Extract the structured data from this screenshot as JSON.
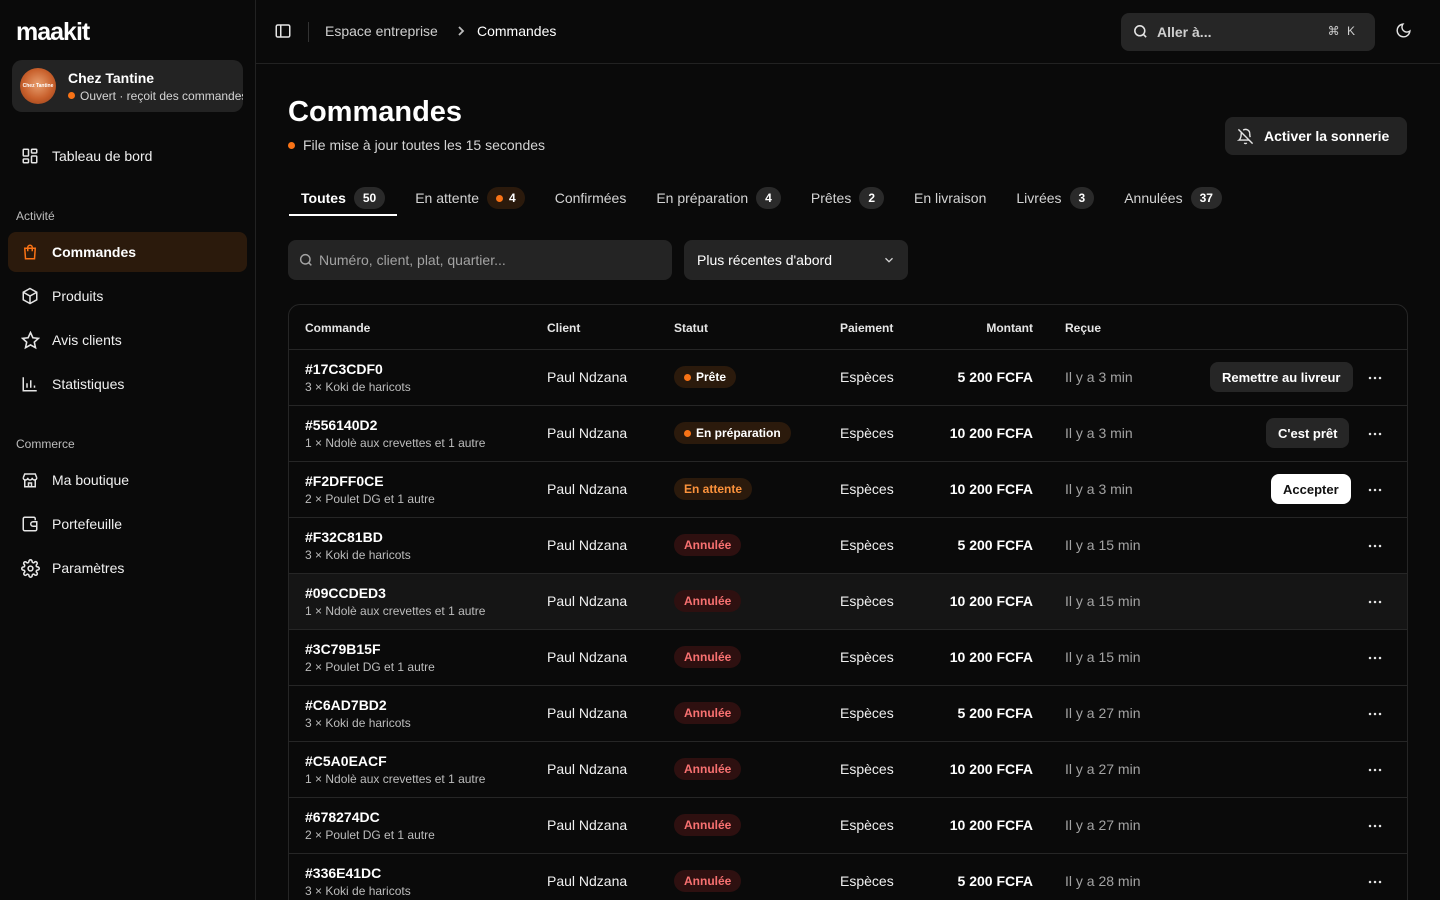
{
  "brand": {
    "logo": "maakit"
  },
  "shop": {
    "name": "Chez Tantine",
    "avatar_text": "Chez Tantine",
    "status": "Ouvert · reçoit des commandes"
  },
  "sidebar": {
    "dashboard": "Tableau de bord",
    "section_activity": "Activité",
    "activity_items": [
      {
        "label": "Commandes",
        "icon": "shopping-bag-icon",
        "active": true
      },
      {
        "label": "Produits",
        "icon": "box-icon",
        "active": false
      },
      {
        "label": "Avis clients",
        "icon": "star-icon",
        "active": false
      },
      {
        "label": "Statistiques",
        "icon": "bar-chart-icon",
        "active": false
      }
    ],
    "section_commerce": "Commerce",
    "commerce_items": [
      {
        "label": "Ma boutique",
        "icon": "store-icon"
      },
      {
        "label": "Portefeuille",
        "icon": "wallet-icon"
      },
      {
        "label": "Paramètres",
        "icon": "gear-icon"
      }
    ]
  },
  "topbar": {
    "breadcrumb": [
      "Espace entreprise",
      "Commandes"
    ],
    "search_label": "Aller à...",
    "shortcut": "⌘ K"
  },
  "header": {
    "title": "Commandes",
    "subtitle": "File mise à jour toutes les 15 secondes",
    "ring_button": "Activer la sonnerie"
  },
  "tabs": [
    {
      "label": "Toutes",
      "count": "50",
      "active": true
    },
    {
      "label": "En attente",
      "count": "4",
      "warn": true
    },
    {
      "label": "Confirmées",
      "count": ""
    },
    {
      "label": "En préparation",
      "count": "4"
    },
    {
      "label": "Prêtes",
      "count": "2"
    },
    {
      "label": "En livraison",
      "count": ""
    },
    {
      "label": "Livrées",
      "count": "3"
    },
    {
      "label": "Annulées",
      "count": "37"
    }
  ],
  "filters": {
    "search_placeholder": "Numéro, client, plat, quartier...",
    "sort_value": "Plus récentes d'abord"
  },
  "table": {
    "columns": [
      "Commande",
      "Client",
      "Statut",
      "Paiement",
      "Montant",
      "Reçue"
    ],
    "rows": [
      {
        "id": "#17C3CDF0",
        "items": "3 × Koki de haricots",
        "client": "Paul Ndzana",
        "status": "Prête",
        "status_kind": "ready",
        "payment": "Espèces",
        "amount": "5 200 FCFA",
        "received": "Il y a 3 min",
        "action": "Remettre au livreur",
        "action_style": "dark"
      },
      {
        "id": "#556140D2",
        "items": "1 × Ndolè aux crevettes et 1 autre",
        "client": "Paul Ndzana",
        "status": "En préparation",
        "status_kind": "prep",
        "payment": "Espèces",
        "amount": "10 200 FCFA",
        "received": "Il y a 3 min",
        "action": "C'est prêt",
        "action_style": "dark"
      },
      {
        "id": "#F2DFF0CE",
        "items": "2 × Poulet DG et 1 autre",
        "client": "Paul Ndzana",
        "status": "En attente",
        "status_kind": "pending",
        "payment": "Espèces",
        "amount": "10 200 FCFA",
        "received": "Il y a 3 min",
        "action": "Accepter",
        "action_style": "light"
      },
      {
        "id": "#F32C81BD",
        "items": "3 × Koki de haricots",
        "client": "Paul Ndzana",
        "status": "Annulée",
        "status_kind": "cancelled",
        "payment": "Espèces",
        "amount": "5 200 FCFA",
        "received": "Il y a 15 min",
        "action": ""
      },
      {
        "id": "#09CCDED3",
        "items": "1 × Ndolè aux crevettes et 1 autre",
        "client": "Paul Ndzana",
        "status": "Annulée",
        "status_kind": "cancelled",
        "payment": "Espèces",
        "amount": "10 200 FCFA",
        "received": "Il y a 15 min",
        "action": "",
        "highlight": true
      },
      {
        "id": "#3C79B15F",
        "items": "2 × Poulet DG et 1 autre",
        "client": "Paul Ndzana",
        "status": "Annulée",
        "status_kind": "cancelled",
        "payment": "Espèces",
        "amount": "10 200 FCFA",
        "received": "Il y a 15 min",
        "action": ""
      },
      {
        "id": "#C6AD7BD2",
        "items": "3 × Koki de haricots",
        "client": "Paul Ndzana",
        "status": "Annulée",
        "status_kind": "cancelled",
        "payment": "Espèces",
        "amount": "5 200 FCFA",
        "received": "Il y a 27 min",
        "action": ""
      },
      {
        "id": "#C5A0EACF",
        "items": "1 × Ndolè aux crevettes et 1 autre",
        "client": "Paul Ndzana",
        "status": "Annulée",
        "status_kind": "cancelled",
        "payment": "Espèces",
        "amount": "10 200 FCFA",
        "received": "Il y a 27 min",
        "action": ""
      },
      {
        "id": "#678274DC",
        "items": "2 × Poulet DG et 1 autre",
        "client": "Paul Ndzana",
        "status": "Annulée",
        "status_kind": "cancelled",
        "payment": "Espèces",
        "amount": "10 200 FCFA",
        "received": "Il y a 27 min",
        "action": ""
      },
      {
        "id": "#336E41DC",
        "items": "3 × Koki de haricots",
        "client": "Paul Ndzana",
        "status": "Annulée",
        "status_kind": "cancelled",
        "payment": "Espèces",
        "amount": "5 200 FCFA",
        "received": "Il y a 28 min",
        "action": ""
      }
    ]
  },
  "colors": {
    "accent": "#f97316",
    "danger": "#f87171",
    "background": "#0a0a0a"
  }
}
